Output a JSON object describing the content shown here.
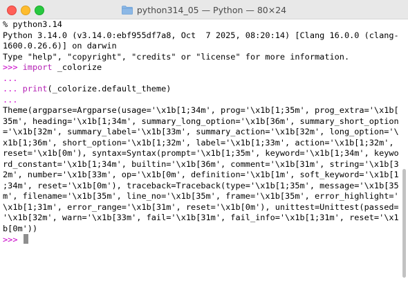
{
  "window": {
    "title": "python314_05 — Python — 80×24",
    "folder_icon": "folder-icon"
  },
  "terminal": {
    "lines": [
      {
        "type": "text",
        "text": "% python3.14"
      },
      {
        "type": "text",
        "text": "Python 3.14.0 (v3.14.0:ebf955df7a8, Oct  7 2025, 08:20:14) [Clang 16.0.0 (clang-"
      },
      {
        "type": "text",
        "text": "1600.0.26.6)] on darwin"
      },
      {
        "type": "text",
        "text": "Type \"help\", \"copyright\", \"credits\" or \"license\" for more information."
      },
      {
        "type": "prompt",
        "prompt": ">>> ",
        "keyword": "import",
        "rest": " _colorize"
      },
      {
        "type": "prompt",
        "prompt": "...",
        "keyword": "",
        "rest": ""
      },
      {
        "type": "prompt",
        "prompt": "... ",
        "keyword": "print",
        "rest": "(_colorize.default_theme)"
      },
      {
        "type": "prompt",
        "prompt": "...",
        "keyword": "",
        "rest": ""
      },
      {
        "type": "text",
        "text": "Theme(argparse=Argparse(usage='\\x1b[1;34m', prog='\\x1b[1;35m', prog_extra='\\x1b["
      },
      {
        "type": "text",
        "text": "35m', heading='\\x1b[1;34m', summary_long_option='\\x1b[36m', summary_short_option"
      },
      {
        "type": "text",
        "text": "='\\x1b[32m', summary_label='\\x1b[33m', summary_action='\\x1b[32m', long_option='\\"
      },
      {
        "type": "text",
        "text": "x1b[1;36m', short_option='\\x1b[1;32m', label='\\x1b[1;33m', action='\\x1b[1;32m',"
      },
      {
        "type": "text",
        "text": "reset='\\x1b[0m'), syntax=Syntax(prompt='\\x1b[1;35m', keyword='\\x1b[1;34m', keywo"
      },
      {
        "type": "text",
        "text": "rd_constant='\\x1b[1;34m', builtin='\\x1b[36m', comment='\\x1b[31m', string='\\x1b[3"
      },
      {
        "type": "text",
        "text": "2m', number='\\x1b[33m', op='\\x1b[0m', definition='\\x1b[1m', soft_keyword='\\x1b[1"
      },
      {
        "type": "text",
        "text": ";34m', reset='\\x1b[0m'), traceback=Traceback(type='\\x1b[1;35m', message='\\x1b[35"
      },
      {
        "type": "text",
        "text": "m', filename='\\x1b[35m', line_no='\\x1b[35m', frame='\\x1b[35m', error_highlight='"
      },
      {
        "type": "text",
        "text": "\\x1b[1;31m', error_range='\\x1b[31m', reset='\\x1b[0m'), unittest=Unittest(passed="
      },
      {
        "type": "text",
        "text": "'\\x1b[32m', warn='\\x1b[33m', fail='\\x1b[31m', fail_info='\\x1b[1;31m', reset='\\x1"
      },
      {
        "type": "text",
        "text": "b[0m'))"
      },
      {
        "type": "cursor",
        "prompt": ">>> "
      }
    ]
  },
  "colors": {
    "prompt": "#c900c9",
    "keyword": "#b31fb3",
    "text": "#000000",
    "background": "#ffffff"
  }
}
